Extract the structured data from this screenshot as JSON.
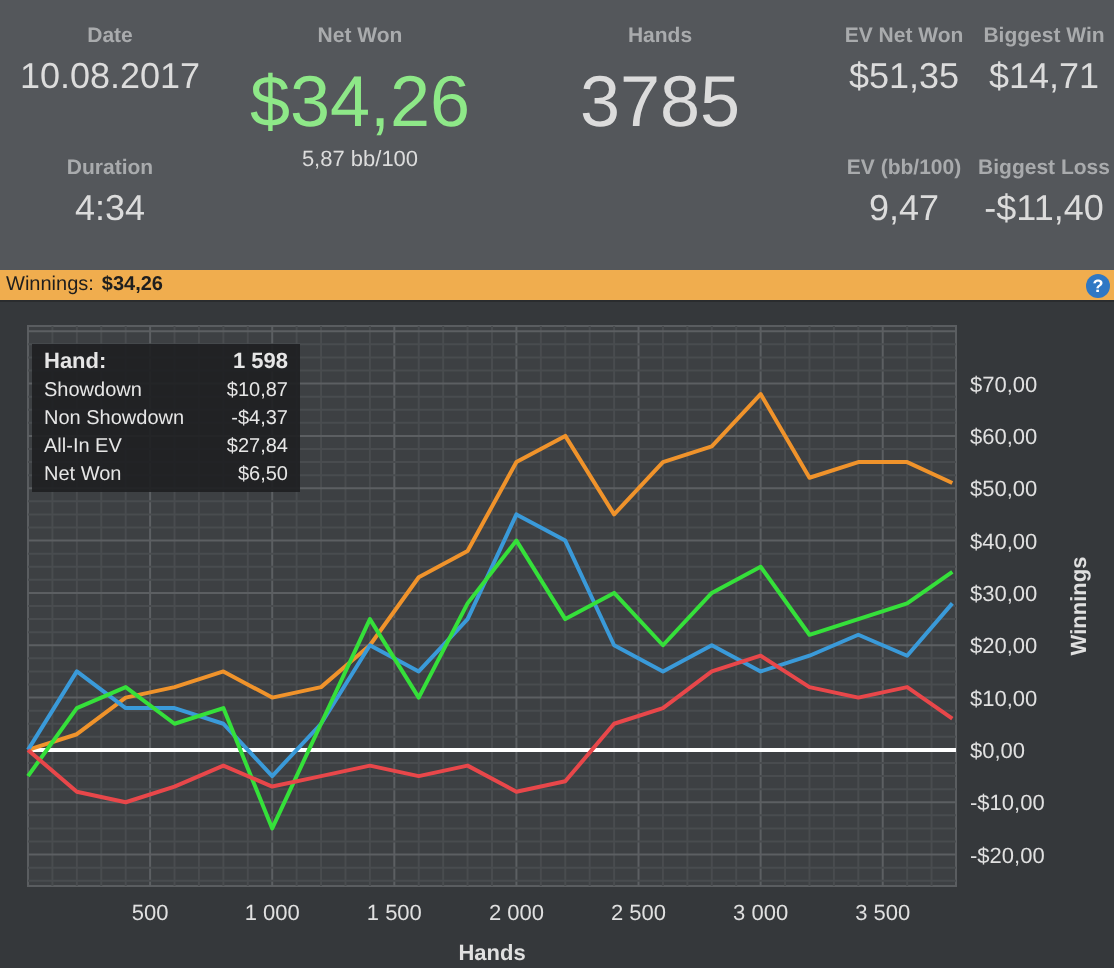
{
  "stats": {
    "date": {
      "label": "Date",
      "value": "10.08.2017"
    },
    "duration": {
      "label": "Duration",
      "value": "4:34"
    },
    "net_won": {
      "label": "Net Won",
      "value": "$34,26",
      "sub": "5,87 bb/100"
    },
    "hands": {
      "label": "Hands",
      "value": "3785"
    },
    "ev_net_won": {
      "label": "EV Net Won",
      "value": "$51,35"
    },
    "biggest_win": {
      "label": "Biggest Win",
      "value": "$14,71"
    },
    "ev_bb100": {
      "label": "EV (bb/100)",
      "value": "9,47"
    },
    "biggest_loss": {
      "label": "Biggest Loss",
      "value": "-$11,40"
    }
  },
  "winnings_bar": {
    "label": "Winnings:",
    "value": "$34,26",
    "help": "?"
  },
  "tooltip": {
    "rows": [
      {
        "label": "Hand:",
        "value": "1 598"
      },
      {
        "label": "Showdown",
        "value": "$10,87"
      },
      {
        "label": "Non Showdown",
        "value": "-$4,37"
      },
      {
        "label": "All-In EV",
        "value": "$27,84"
      },
      {
        "label": "Net Won",
        "value": "$6,50"
      }
    ]
  },
  "chart": {
    "chart_data": {
      "type": "line",
      "xlabel": "Hands",
      "ylabel": "Winnings",
      "x": [
        0,
        200,
        400,
        600,
        800,
        1000,
        1200,
        1400,
        1600,
        1800,
        2000,
        2200,
        2400,
        2600,
        2800,
        3000,
        3200,
        3400,
        3600,
        3785
      ],
      "series": [
        {
          "color": "#f0932b",
          "values": [
            0,
            3,
            10,
            12,
            15,
            10,
            12,
            20,
            33,
            38,
            55,
            60,
            45,
            55,
            58,
            68,
            52,
            55,
            55,
            51
          ]
        },
        {
          "color": "#3a9ad9",
          "values": [
            0,
            15,
            8,
            8,
            5,
            -5,
            5,
            20,
            15,
            25,
            45,
            40,
            20,
            15,
            20,
            15,
            18,
            22,
            18,
            28
          ]
        },
        {
          "color": "#35e03a",
          "values": [
            -5,
            8,
            12,
            5,
            8,
            -15,
            5,
            25,
            10,
            28,
            40,
            25,
            30,
            20,
            30,
            35,
            22,
            25,
            28,
            34
          ]
        },
        {
          "color": "#e8474a",
          "values": [
            0,
            -8,
            -10,
            -7,
            -3,
            -7,
            -5,
            -3,
            -5,
            -3,
            -8,
            -6,
            5,
            8,
            15,
            18,
            12,
            10,
            12,
            6
          ]
        }
      ],
      "xlim": [
        0,
        3800
      ],
      "ylim": [
        -26,
        81
      ],
      "grid": true,
      "xticks": [
        {
          "value": 500,
          "label": "500"
        },
        {
          "value": 1000,
          "label": "1 000"
        },
        {
          "value": 1500,
          "label": "1 500"
        },
        {
          "value": 2000,
          "label": "2 000"
        },
        {
          "value": 2500,
          "label": "2 500"
        },
        {
          "value": 3000,
          "label": "3 000"
        },
        {
          "value": 3500,
          "label": "3 500"
        }
      ],
      "yticks": [
        {
          "value": 70,
          "label": "$70,00"
        },
        {
          "value": 60,
          "label": "$60,00"
        },
        {
          "value": 50,
          "label": "$50,00"
        },
        {
          "value": 40,
          "label": "$40,00"
        },
        {
          "value": 30,
          "label": "$30,00"
        },
        {
          "value": 20,
          "label": "$20,00"
        },
        {
          "value": 10,
          "label": "$10,00"
        },
        {
          "value": 0,
          "label": "$0,00"
        },
        {
          "value": -10,
          "label": "-$10,00"
        },
        {
          "value": -20,
          "label": "-$20,00"
        }
      ]
    }
  }
}
